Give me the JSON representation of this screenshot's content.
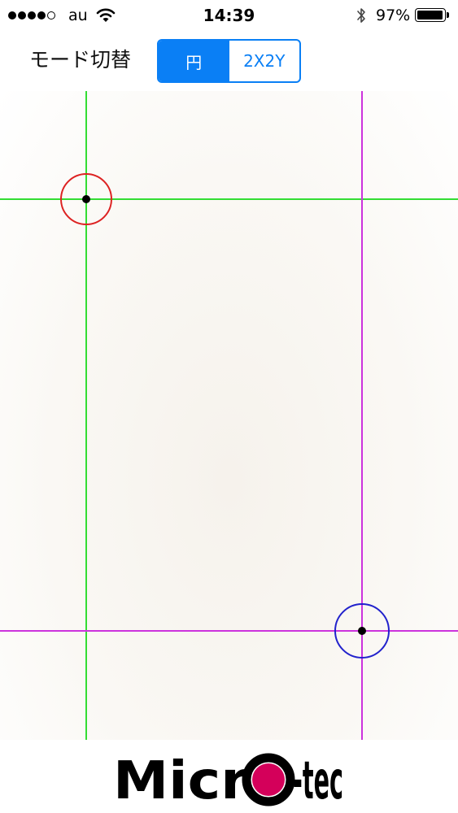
{
  "status_bar": {
    "carrier": "au",
    "time": "14:39",
    "battery_percent": "97%",
    "battery_level": 0.97,
    "signal_bars_filled": 4,
    "signal_bars_total": 5,
    "icons": [
      "signal-dots",
      "wifi-icon",
      "bluetooth-icon",
      "battery-icon"
    ]
  },
  "toolbar": {
    "mode_label": "モード切替",
    "segments": [
      {
        "label": "円",
        "selected": true
      },
      {
        "label": "2X2Y",
        "selected": false
      }
    ],
    "accent_color": "#0a7ff5"
  },
  "crosshair_1": {
    "line_color": "#33dd33",
    "circle_color": "#dd2222"
  },
  "crosshair_2": {
    "line_color": "#cc33dd",
    "circle_color": "#2222cc"
  },
  "logo": {
    "text_before": "Micr",
    "text_after": "-tec",
    "dot_color": "#d4005a"
  }
}
